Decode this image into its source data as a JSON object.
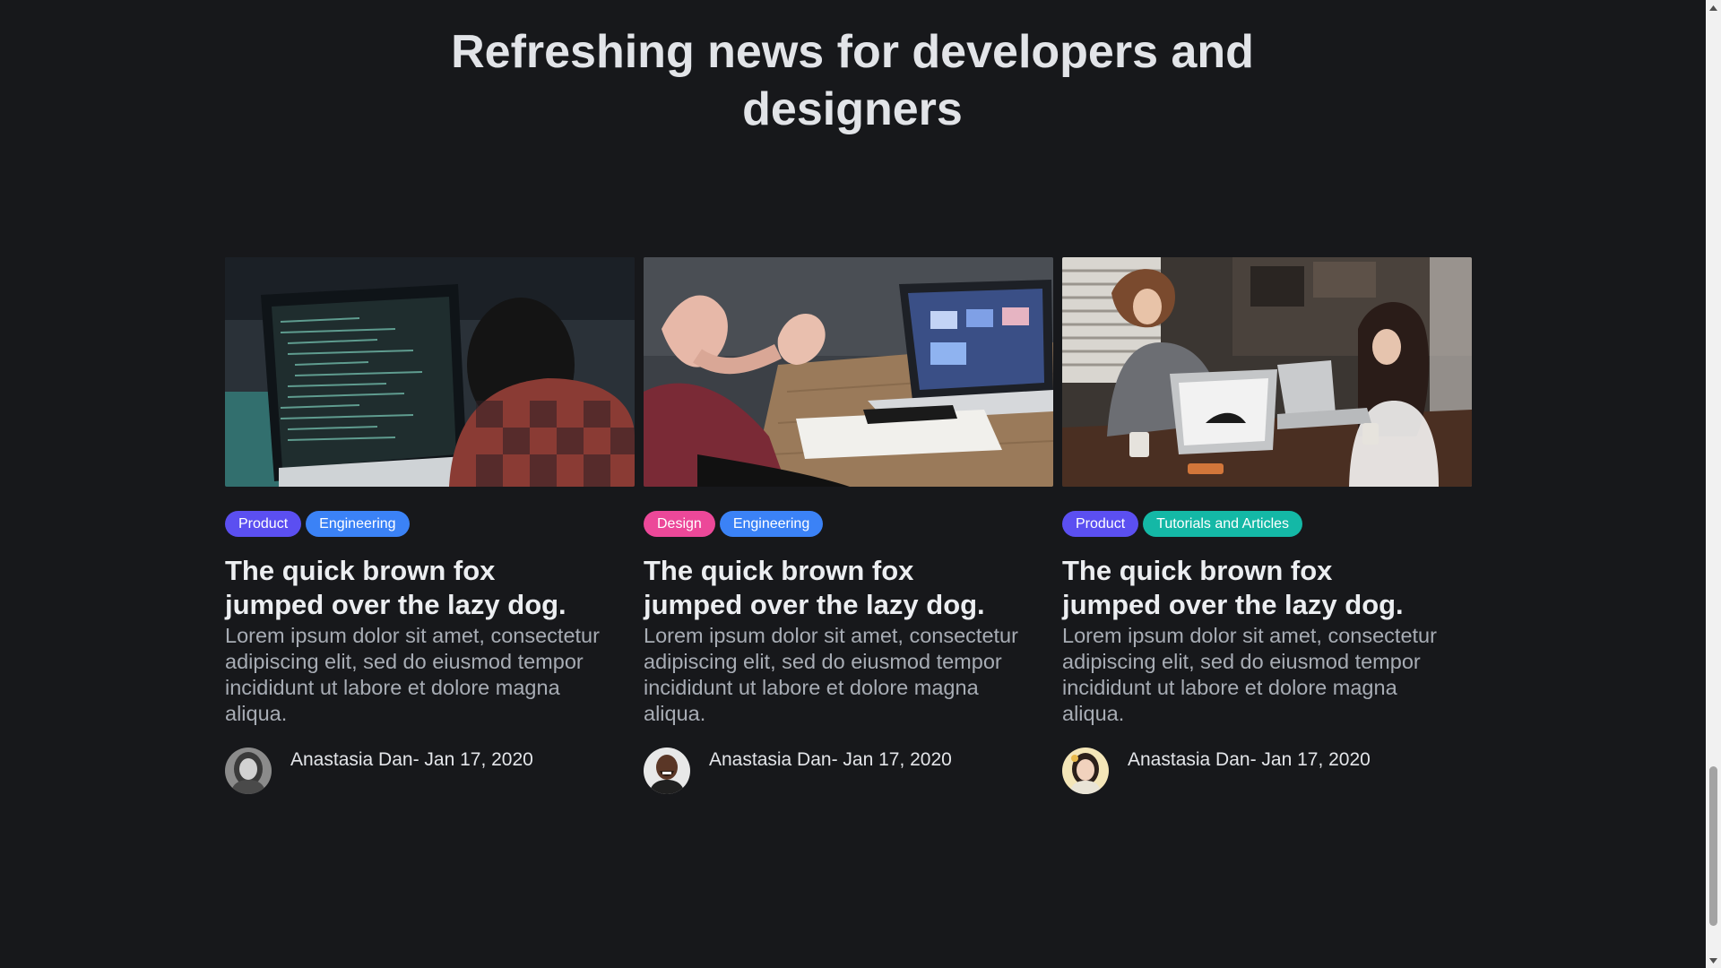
{
  "page": {
    "title_line1": "Refreshing news for developers and",
    "title_line2": "designers",
    "background": "#17181b"
  },
  "tag_colors": {
    "Product": "#5b4ff1",
    "Engineering": "#3b82f6",
    "Design": "#ec4899",
    "Tutorials and Articles": "#14b8a6"
  },
  "cards": [
    {
      "image": "developer-coding-photo",
      "tags": [
        {
          "label": "Product",
          "color": "#5b4ff1"
        },
        {
          "label": "Engineering",
          "color": "#3b82f6"
        }
      ],
      "title_line1": "The quick brown fox",
      "title_line2": "jumped over the lazy dog.",
      "excerpt_lines": [
        "Lorem ipsum dolor sit amet, consectetur",
        "adipiscing elit, sed do eiusmod tempor",
        "incididunt ut labore et dolore magna",
        "aliqua."
      ],
      "author": "Anastasia Dan- Jan 17, 2020",
      "avatar": "woman-avatar-bw"
    },
    {
      "image": "laptop-meeting-photo",
      "tags": [
        {
          "label": "Design",
          "color": "#ec4899"
        },
        {
          "label": "Engineering",
          "color": "#3b82f6"
        }
      ],
      "title_line1": "The quick brown fox",
      "title_line2": "jumped over the lazy dog.",
      "excerpt_lines": [
        "Lorem ipsum dolor sit amet, consectetur",
        "adipiscing elit, sed do eiusmod tempor",
        "incididunt ut labore et dolore magna",
        "aliqua."
      ],
      "author": "Anastasia Dan- Jan 17, 2020",
      "avatar": "man-avatar-smiling"
    },
    {
      "image": "team-laptops-photo",
      "tags": [
        {
          "label": "Product",
          "color": "#5b4ff1"
        },
        {
          "label": "Tutorials and Articles",
          "color": "#14b8a6"
        }
      ],
      "title_line1": "The quick brown fox",
      "title_line2": "jumped over the lazy dog.",
      "excerpt_lines": [
        "Lorem ipsum dolor sit amet, consectetur",
        "adipiscing elit, sed do eiusmod tempor",
        "incididunt ut labore et dolore magna",
        "aliqua."
      ],
      "author": "Anastasia Dan- Jan 17, 2020",
      "avatar": "woman-avatar-color"
    }
  ]
}
